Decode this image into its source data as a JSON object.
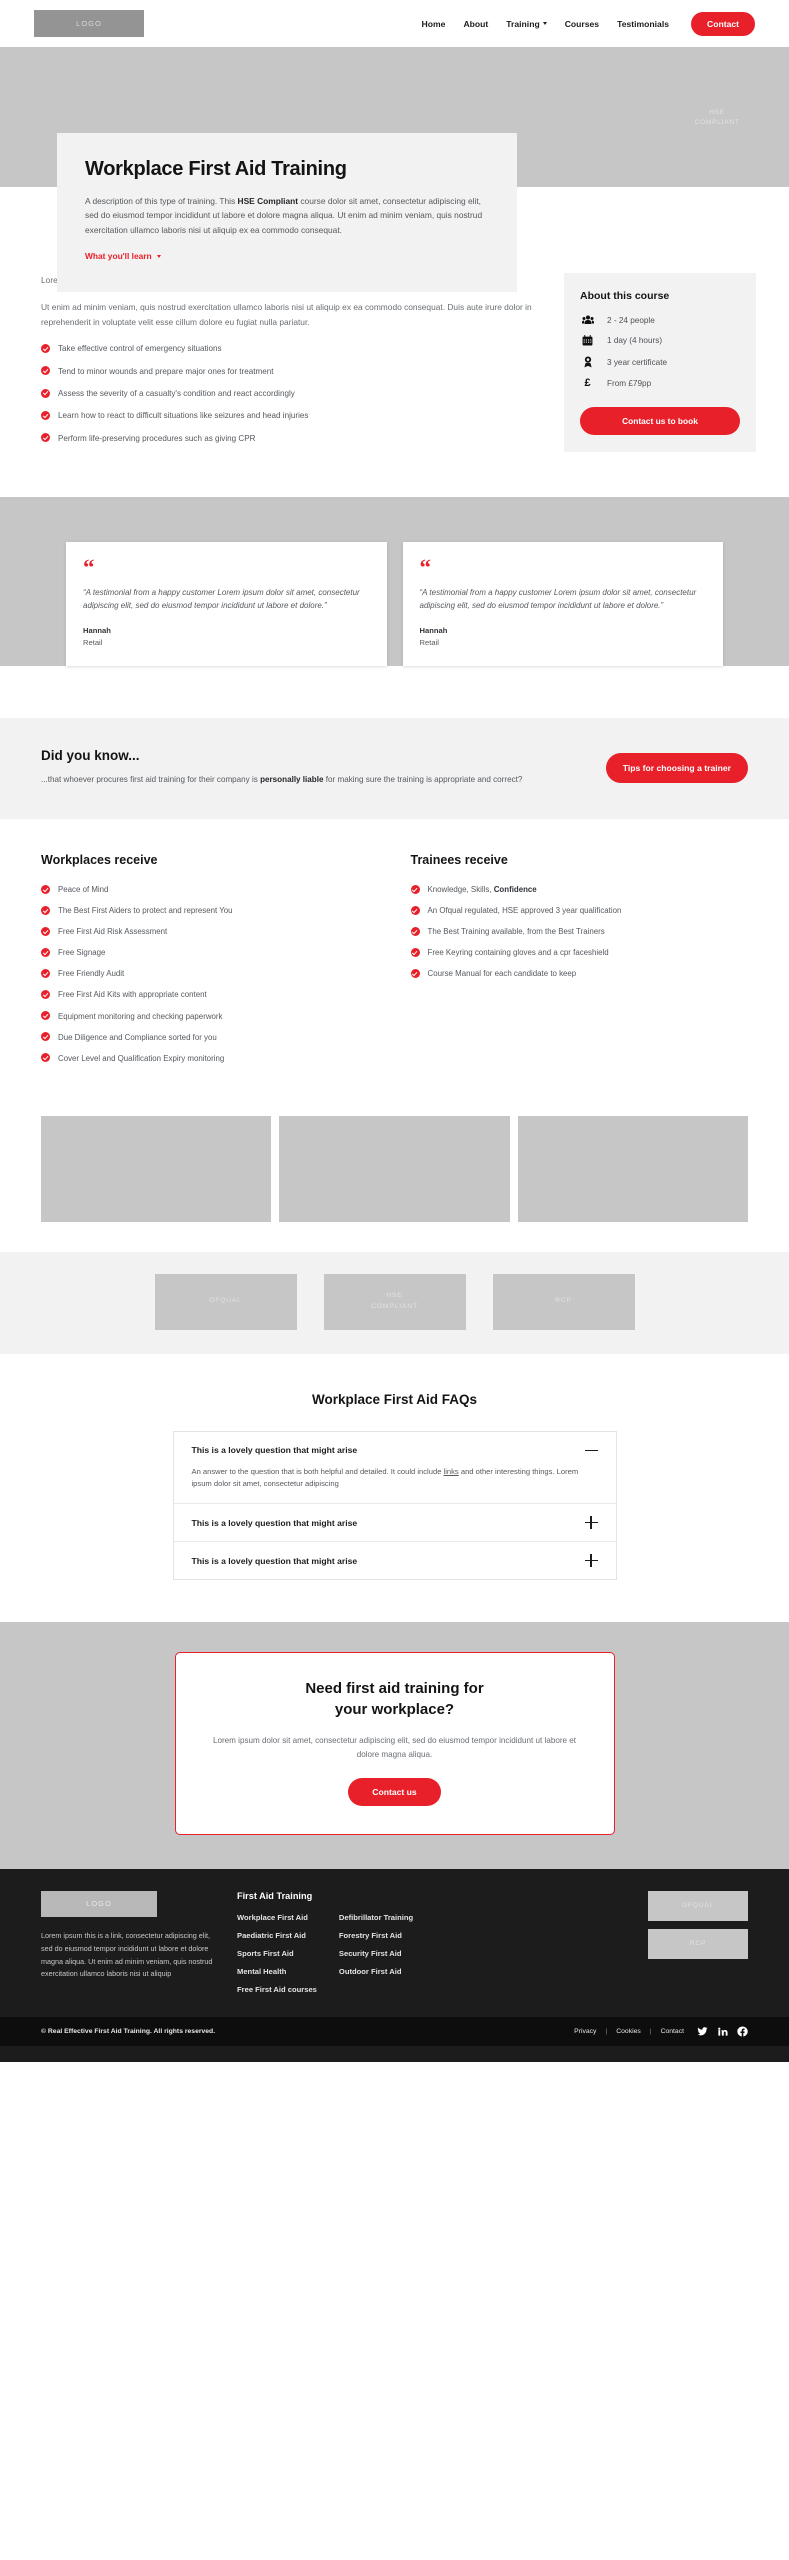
{
  "brand": {
    "accent": "#e8202a",
    "logo_label": "LOGO"
  },
  "header": {
    "nav": [
      {
        "label": "Home",
        "has_caret": false
      },
      {
        "label": "About",
        "has_caret": false
      },
      {
        "label": "Training",
        "has_caret": true
      },
      {
        "label": "Courses",
        "has_caret": false
      },
      {
        "label": "Testimonials",
        "has_caret": false
      }
    ],
    "cta_label": "Contact"
  },
  "hero": {
    "title": "Workplace First Aid Training",
    "description_pre": "A description of this type of training. This ",
    "description_bold": "HSE Compliant",
    "description_post": " course dolor sit amet, consectetur adipiscing elit, sed do eiusmod tempor incididunt ut labore et dolore magna aliqua. Ut enim ad minim veniam, quis nostrud exercitation ullamco laboris nisi ut aliquip ex ea commodo consequat.",
    "learn_link": "What you'll learn",
    "badge_label": "HSE COMPLIANT"
  },
  "course": {
    "paragraph_1": "Lorem ipsum dolor sit amet, consectetur adipiscing elit, sed do eiusmod tempor incididunt ut labore et dolore magna aliqua.",
    "paragraph_2": "Ut enim ad minim veniam, quis nostrud exercitation ullamco laboris nisi ut aliquip ex ea commodo consequat. Duis aute irure dolor in reprehenderit in voluptate velit esse cillum dolore eu fugiat nulla pariatur.",
    "bullets": [
      "Take effective control of emergency situations",
      "Tend to minor wounds and prepare major ones for treatment",
      "Assess the severity of a casualty's condition and react accordingly",
      "Learn how to react to difficult situations like seizures and head injuries",
      "Perform life-preserving procedures such as giving CPR"
    ],
    "about": {
      "title": "About this course",
      "facts": [
        {
          "icon": "people-icon",
          "label": "2 - 24 people"
        },
        {
          "icon": "calendar-icon",
          "label": "1 day (4 hours)"
        },
        {
          "icon": "award-icon",
          "label": "3 year certificate"
        },
        {
          "icon": "pound-icon",
          "label": "From £79pp"
        }
      ],
      "cta_label": "Contact us to book"
    }
  },
  "testimonials": [
    {
      "quote": "“A testimonial from a happy customer Lorem ipsum dolor sit amet, consectetur adipiscing elit, sed do eiusmod tempor incididunt ut labore et dolore.”",
      "name": "Hannah",
      "role": "Retail"
    },
    {
      "quote": "“A testimonial from a happy customer Lorem ipsum dolor sit amet, consectetur adipiscing elit, sed do eiusmod tempor incididunt ut labore et dolore.”",
      "name": "Hannah",
      "role": "Retail"
    }
  ],
  "did_you_know": {
    "title": "Did you know...",
    "text_pre": "...that whoever procures first aid training for their company is ",
    "text_bold": "personally liable",
    "text_post": " for making sure the training is appropriate and correct?",
    "cta_label": "Tips for choosing a trainer"
  },
  "receive": {
    "workplaces": {
      "title": "Workplaces receive",
      "items": [
        "Peace of Mind",
        "The Best First Aiders to protect and represent You",
        "Free First Aid Risk Assessment",
        "Free Signage",
        "Free Friendly Audit",
        "Free First Aid Kits with appropriate content",
        "Equipment monitoring and checking paperwork",
        "Due Diligence and Compliance sorted for you",
        "Cover Level and Qualification Expiry monitoring"
      ]
    },
    "trainees": {
      "title": "Trainees receive",
      "items": [
        {
          "pre": "Knowledge, Skills, ",
          "bold": "Confidence",
          "post": ""
        },
        {
          "pre": "An Ofqual regulated, HSE approved 3 year qualification",
          "bold": "",
          "post": ""
        },
        {
          "pre": "The Best Training available, from the Best Trainers",
          "bold": "",
          "post": ""
        },
        {
          "pre": "Free Keyring containing gloves and a cpr faceshield",
          "bold": "",
          "post": ""
        },
        {
          "pre": "Course Manual for each candidate to keep",
          "bold": "",
          "post": ""
        }
      ]
    }
  },
  "accreditations": [
    {
      "label": "OFQUAL"
    },
    {
      "label": "HSE COMPLIANT"
    },
    {
      "label": "RCP"
    }
  ],
  "faq": {
    "title": "Workplace First Aid FAQs",
    "items": [
      {
        "question": "This is a lovely question that might arise",
        "open": true,
        "answer_pre": "An answer to the question that is both helpful and detailed. It could include ",
        "answer_link": "links",
        "answer_post": " and other interesting things. Lorem ipsum dolor sit amet, consectetur adipiscing"
      },
      {
        "question": "This is a lovely question that might arise",
        "open": false
      },
      {
        "question": "This is a lovely question that might arise",
        "open": false
      }
    ]
  },
  "cta": {
    "title_line_1": "Need first aid training for",
    "title_line_2": "your workplace?",
    "text": "Lorem ipsum dolor sit amet, consectetur adipiscing elit, sed do eiusmod tempor incididunt ut labore et dolore magna aliqua.",
    "button_label": "Contact us"
  },
  "footer": {
    "logo_label": "LOGO",
    "about": "Lorem ipsum this is a link, consectetur adipiscing elit, sed do eiusmod tempor incididunt ut labore et dolore magna aliqua. Ut enim ad minim veniam, quis nostrud exercitation ullamco laboris nisi ut aliquip",
    "links_title": "First Aid Training",
    "links_col_1": [
      "Workplace First Aid",
      "Paediatric First Aid",
      "Sports First Aid",
      "Mental Health",
      "Free First Aid courses"
    ],
    "links_col_2": [
      "Defibrillator Training",
      "Forestry First Aid",
      "Security First Aid",
      "Outdoor First Aid"
    ],
    "badges": [
      "OFQUAL",
      "RCP"
    ],
    "copyright": "© Real Effective First Aid Training. All rights reserved.",
    "legal_links": [
      "Privacy",
      "Cookies",
      "Contact"
    ],
    "socials": [
      "twitter-icon",
      "linkedin-icon",
      "facebook-icon"
    ]
  }
}
